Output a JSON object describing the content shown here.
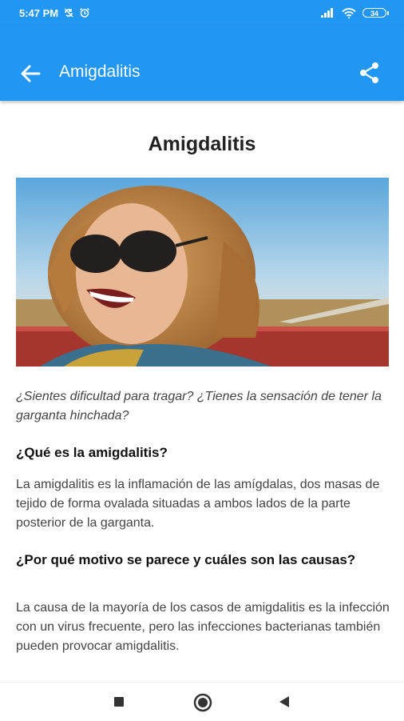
{
  "status_bar": {
    "time": "5:47 PM",
    "battery": "34",
    "icons": [
      "sync-icon",
      "alarm-icon",
      "signal-icon",
      "wifi-icon",
      "battery-icon"
    ]
  },
  "app_bar": {
    "title": "Amigdalitis",
    "back_icon": "arrow-back-icon",
    "share_icon": "share-icon",
    "color": "#2196f3"
  },
  "article": {
    "title": "Amigdalitis",
    "image": "woman-sunglasses-laughing-photo",
    "intro": "¿Sientes dificultad para tragar? ¿Tienes la sensación de tener la garganta hinchada?",
    "sections": [
      {
        "heading": "¿Qué es la amigdalitis?",
        "text": "La amigdalitis es la inflamación de las amígdalas, dos masas de tejido de forma ovalada situadas a ambos lados de la parte posterior de la garganta."
      },
      {
        "heading": "¿Por qué motivo se parece y cuáles son las causas?",
        "text": "La causa de la mayoría de los casos de amigdalitis es la infección con un virus frecuente, pero las infecciones bacterianas también pueden provocar amigdalitis."
      }
    ]
  },
  "nav_bar": {
    "icons": [
      "recents-square-icon",
      "home-circle-icon",
      "back-triangle-icon"
    ]
  }
}
